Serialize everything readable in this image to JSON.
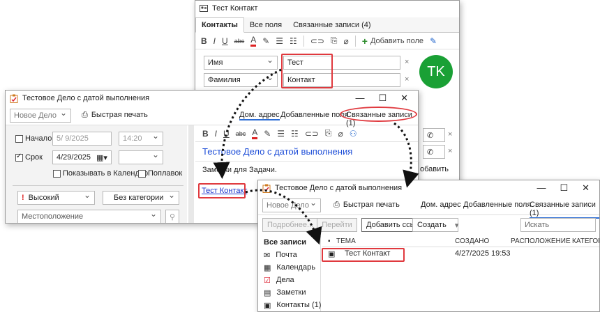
{
  "contact_window": {
    "title": "Тест Контакт",
    "tabs": [
      "Контакты",
      "Все поля",
      "Связанные записи  (4)"
    ],
    "add_field_label": "Добавить поле",
    "first_name_label": "Имя",
    "first_name_value": "Тест",
    "last_name_label": "Фамилия",
    "last_name_value": "Контакт",
    "avatar_initials": "TK",
    "avatar_color": "#1aa035",
    "add_label_partial": "обавить"
  },
  "task_window": {
    "title": "Тестовое Дело с датой выполнения",
    "new_task": "Новое Дело",
    "quick_print": "Быстрая печать",
    "tabs": [
      "Дом. адрес",
      "Добавленные поля",
      "Связанные записи  (1)"
    ],
    "start_label": "Начало",
    "start_date": "5/  9/2025",
    "start_time": "14:20",
    "due_label": "Срок",
    "due_date": "4/29/2025",
    "show_in_calendar": "Показывать в Календар",
    "floating": "Поплавок",
    "priority": "Высокий",
    "category": "Без категории",
    "location_placeholder": "Местоположение",
    "subject_heading": "Тестовое Дело с датой выполнения",
    "notes": "Заметки для Задачи.",
    "linked_contact": "Тест Контакт"
  },
  "related_window": {
    "title": "Тестовое Дело с датой выполнения",
    "new_task": "Новое Дело",
    "quick_print": "Быстрая печать",
    "tabs": [
      "Дом. адрес",
      "Добавленные поля",
      "Связанные записи  (1)"
    ],
    "btn_details": "Подробнее...",
    "btn_goto": "Перейти",
    "btn_add_link": "Добавить ссыл",
    "btn_create": "Создать",
    "search_placeholder": "Искать",
    "sidebar_header": "Все записи",
    "sidebar_items": [
      "Почта",
      "Календарь",
      "Дела",
      "Заметки",
      "Контакты  (1)"
    ],
    "columns": [
      "ТЕМА",
      "СОЗДАНО",
      "РАСПОЛОЖЕНИЕ ...",
      "КАТЕГОР"
    ],
    "rows": [
      {
        "subject": "Тест Контакт",
        "created": "4/27/2025 19:53",
        "location": "",
        "category": ""
      }
    ]
  }
}
